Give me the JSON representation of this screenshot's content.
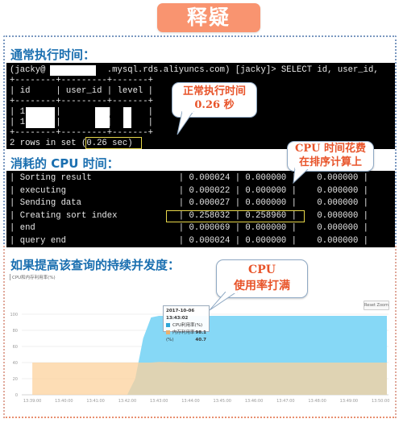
{
  "header": {
    "title": "释疑"
  },
  "sections": {
    "normal_time": "通常执行时间：",
    "cpu_time": "消耗的 CPU 时间：",
    "concurrency": "如果提高该查询的持续并发度："
  },
  "terminal1": {
    "lines": [
      "(jacky@            .mysql.rds.aliyuncs.com) [jacky]> SELECT id, user_id,",
      "+--------+---------+-------+",
      "| id     | user_id | level |",
      "+--------+---------+-------+",
      "| 1      |         |       |",
      "| 1      |         |       |",
      "+--------+---------+-------+",
      "2 rows in set (0.26 sec)"
    ],
    "highlight": "(0.26 sec)"
  },
  "terminal2": {
    "rows": [
      {
        "status": "Sorting result",
        "duration": "0.000024",
        "cpu_user": "0.000000",
        "cpu_system": "0.000000"
      },
      {
        "status": "executing",
        "duration": "0.000022",
        "cpu_user": "0.000000",
        "cpu_system": "0.000000"
      },
      {
        "status": "Sending data",
        "duration": "0.000027",
        "cpu_user": "0.000000",
        "cpu_system": "0.000000"
      },
      {
        "status": "Creating sort index",
        "duration": "0.258032",
        "cpu_user": "0.258960",
        "cpu_system": "0.000000"
      },
      {
        "status": "end",
        "duration": "0.000069",
        "cpu_user": "0.000000",
        "cpu_system": "0.000000"
      },
      {
        "status": "query end",
        "duration": "0.000024",
        "cpu_user": "0.000000",
        "cpu_system": "0.000000"
      }
    ]
  },
  "callouts": {
    "normal": {
      "line1": "正常执行时间",
      "line2": "0.26 秒"
    },
    "cpu_sort": {
      "line1": "CPU 时间花费",
      "line2": "在排序计算上"
    },
    "cpu_full": {
      "line1": "CPU",
      "line2": "使用率打满"
    }
  },
  "chart": {
    "reset_zoom_label": "Reset Zoom",
    "tooltip": {
      "time": "2017-10-06 13:43:02",
      "items": [
        {
          "label": "CPU利用率(%)",
          "value": "98.1",
          "color": "#2fa6d6"
        },
        {
          "label": "内存利用率(%)",
          "value": "40.7",
          "color": "#e8b070"
        }
      ]
    }
  },
  "chart_data": {
    "type": "area",
    "title": "CPU和内存利用率(%)",
    "xlabel": "",
    "ylabel": "",
    "x": [
      "13:39:00",
      "13:40:00",
      "13:41:00",
      "13:42:00",
      "13:42:15",
      "13:42:30",
      "13:42:45",
      "13:43:00",
      "13:44:00",
      "13:45:00",
      "13:46:00",
      "13:47:00",
      "13:48:00",
      "13:49:00",
      "13:50:00",
      "13:50:15"
    ],
    "x_ticks": [
      "13:39:00",
      "13:40:00",
      "13:41:00",
      "13:42:00",
      "13:43:00",
      "13:44:00",
      "13:45:00",
      "13:46:00",
      "13:47:00",
      "13:48:00",
      "13:49:00",
      "13:50:00"
    ],
    "y_ticks": [
      0,
      20,
      40,
      60,
      80,
      100
    ],
    "ylim": [
      0,
      100
    ],
    "grid": true,
    "series": [
      {
        "name": "CPU利用率(%)",
        "color": "#7fd6f6",
        "values": [
          0,
          0,
          0,
          0,
          20,
          70,
          96,
          98,
          98,
          98,
          98,
          98,
          98,
          98,
          98,
          98
        ]
      },
      {
        "name": "内存利用率(%)",
        "color": "#fcd19c",
        "values": [
          40,
          40,
          40,
          40,
          40,
          40,
          40,
          40.7,
          40,
          40,
          40,
          40,
          40,
          40,
          40,
          40
        ]
      }
    ]
  }
}
